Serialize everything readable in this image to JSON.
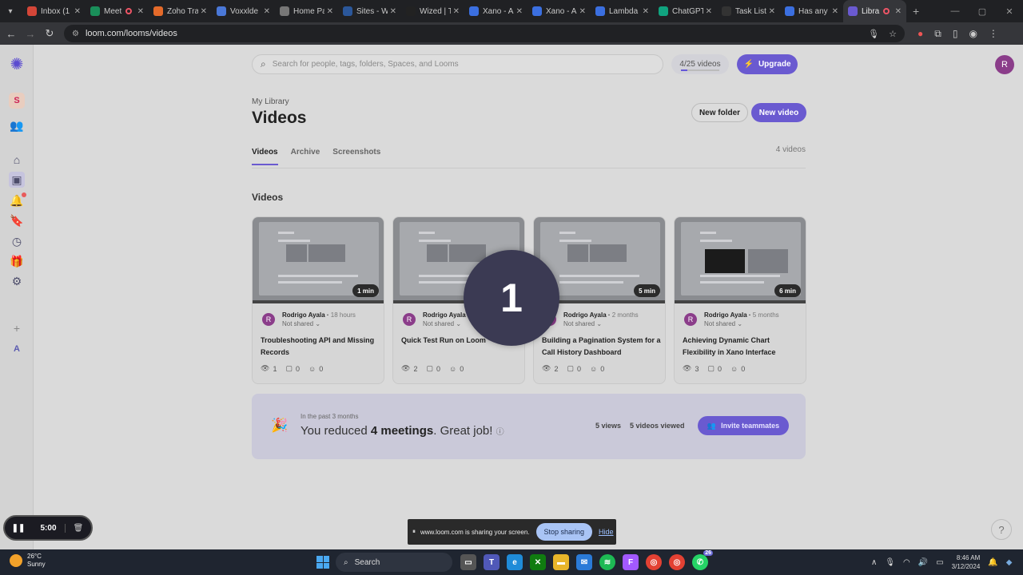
{
  "browser": {
    "tabs": [
      {
        "label": "Inbox (1",
        "icon": "gmail-icon",
        "color": "#d44638"
      },
      {
        "label": "Meet",
        "icon": "meet-icon",
        "color": "#1a8f5a",
        "recording": true
      },
      {
        "label": "Zoho Tra",
        "icon": "zoho-icon",
        "color": "#e46a2a"
      },
      {
        "label": "Voxxlde",
        "icon": "doc-icon",
        "color": "#4a78d8"
      },
      {
        "label": "Home Pa",
        "icon": "globe-icon",
        "color": "#777"
      },
      {
        "label": "Sites - W",
        "icon": "word-icon",
        "color": "#2b579a"
      },
      {
        "label": "Wized | T",
        "icon": "wized-icon",
        "color": "#222"
      },
      {
        "label": "Xano - A",
        "icon": "xano-icon",
        "color": "#3b6fe0"
      },
      {
        "label": "Xano - A",
        "icon": "xano-icon",
        "color": "#3b6fe0"
      },
      {
        "label": "Lambda",
        "icon": "xano-icon",
        "color": "#3b6fe0"
      },
      {
        "label": "ChatGPT",
        "icon": "chatgpt-icon",
        "color": "#10a37f"
      },
      {
        "label": "Task List",
        "icon": "notion-icon",
        "color": "#333"
      },
      {
        "label": "Has any",
        "icon": "xano-icon",
        "color": "#3b6fe0"
      },
      {
        "label": "Libra",
        "icon": "loom-icon",
        "color": "#6a5ad0",
        "active": true,
        "recording": true
      }
    ],
    "url": "loom.com/looms/videos"
  },
  "topbar": {
    "search_placeholder": "Search for people, tags, folders, Spaces, and Looms",
    "quota": "4/25 videos",
    "quota_fraction": 0.16,
    "upgrade": "Upgrade",
    "avatar": "R"
  },
  "sidebar": {
    "workspace": "S",
    "account": "A"
  },
  "header": {
    "breadcrumb": "My Library",
    "title": "Videos",
    "new_folder": "New folder",
    "new_video": "New video",
    "count": "4 videos"
  },
  "tabs": [
    "Videos",
    "Archive",
    "Screenshots"
  ],
  "section_title": "Videos",
  "videos": [
    {
      "owner": "Rodrigo Ayala",
      "ago": "18 hours",
      "shared": "Not shared",
      "title": "Troubleshooting API and Missing Records",
      "duration": "1 min",
      "views": "1",
      "comments": "0",
      "reactions": "0",
      "avatar": "R"
    },
    {
      "owner": "Rodrigo Ayala",
      "ago": "",
      "shared": "Not shared",
      "title": "Quick Test Run on Loom",
      "duration": "",
      "views": "2",
      "comments": "0",
      "reactions": "0",
      "avatar": "R"
    },
    {
      "owner": "Rodrigo Ayala",
      "ago": "2 months",
      "shared": "Not shared",
      "title": "Building a Pagination System for a Call History Dashboard",
      "duration": "5 min",
      "views": "2",
      "comments": "0",
      "reactions": "0",
      "avatar": "R"
    },
    {
      "owner": "Rodrigo Ayala",
      "ago": "5 months",
      "shared": "Not shared",
      "title": "Achieving Dynamic Chart Flexibility in Xano Interface",
      "duration": "6 min",
      "views": "3",
      "comments": "0",
      "reactions": "0",
      "avatar": "R"
    }
  ],
  "countdown": "1",
  "banner": {
    "caption": "In the past 3 months",
    "prefix": "You reduced ",
    "highlight": "4 meetings",
    "suffix": ". Great job!",
    "views": "5 views",
    "videos_viewed": "5 videos viewed",
    "invite": "Invite teammates"
  },
  "recorder": {
    "time": "5:00"
  },
  "sharebar": {
    "message": "www.loom.com is sharing your screen.",
    "stop": "Stop sharing",
    "hide": "Hide"
  },
  "taskbar": {
    "temp": "26°C",
    "weather": "Sunny",
    "search": "Search",
    "time": "8:46 AM",
    "date": "3/12/2024",
    "whatsapp_badge": "26"
  },
  "colors": {
    "accent": "#6a5ad0",
    "avatar": "#8b3d8a"
  }
}
